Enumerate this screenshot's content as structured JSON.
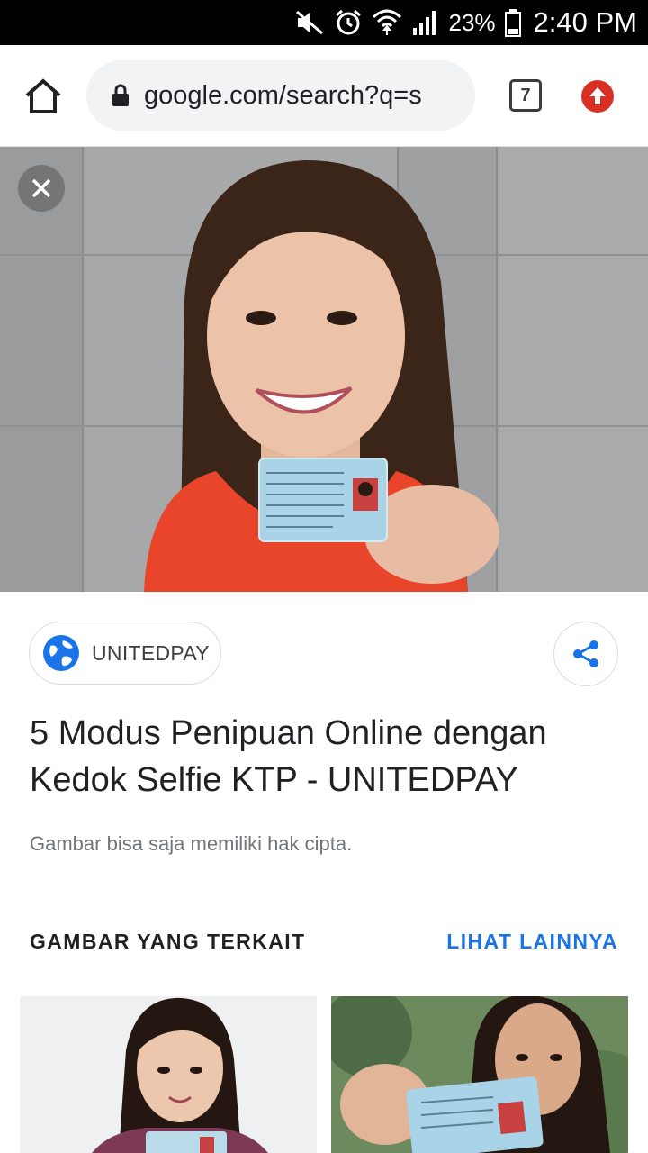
{
  "status_bar": {
    "battery": "23%",
    "time": "2:40 PM",
    "icons": [
      "mute-icon",
      "alarm-icon",
      "wifi-icon",
      "signal-icon",
      "battery-icon"
    ]
  },
  "toolbar": {
    "url": "google.com/search?q=s",
    "tab_count": "7",
    "icons": [
      "home-icon",
      "lock-icon",
      "update-icon"
    ]
  },
  "result": {
    "source": "UNITEDPAY",
    "title": "5 Modus Penipuan Online dengan Kedok Selfie KTP - UNITEDPAY",
    "copyright_note": "Gambar bisa saja memiliki hak cipta."
  },
  "related": {
    "heading": "GAMBAR YANG TERKAIT",
    "see_more": "LIHAT LAINNYA"
  },
  "colors": {
    "accent": "#1a73e8",
    "update_red": "#d93025",
    "title_text": "#202124",
    "muted_text": "#70757a"
  }
}
